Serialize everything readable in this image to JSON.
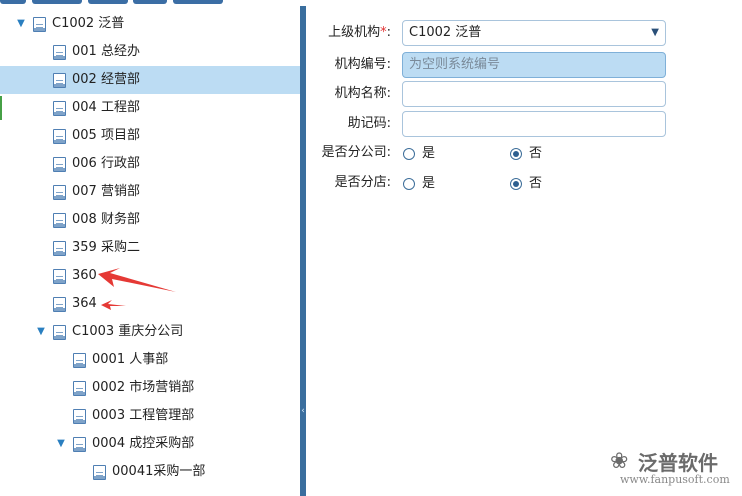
{
  "tree": {
    "nodes": [
      {
        "label": "C1002 泛普",
        "expanded": true
      },
      {
        "label": "001 总经办"
      },
      {
        "label": "002 经营部",
        "selected": true
      },
      {
        "label": "004 工程部"
      },
      {
        "label": "005 项目部"
      },
      {
        "label": "006 行政部"
      },
      {
        "label": "007 营销部"
      },
      {
        "label": "008 财务部"
      },
      {
        "label": "359 采购二"
      },
      {
        "label": "360"
      },
      {
        "label": "364"
      },
      {
        "label": "C1003 重庆分公司",
        "expanded": true
      },
      {
        "label": "0001 人事部"
      },
      {
        "label": "0002 市场营销部"
      },
      {
        "label": "0003 工程管理部"
      },
      {
        "label": "0004 成控采购部",
        "expanded": true
      },
      {
        "label": "00041采购一部"
      }
    ]
  },
  "form": {
    "parent_label": "上级机构",
    "required_mark": "*",
    "colon": ":",
    "parent_value": "C1002 泛普",
    "code_label": "机构编号:",
    "code_placeholder": "为空则系统编号",
    "name_label": "机构名称:",
    "mnemonic_label": "助记码:",
    "branch_company_label": "是否分公司:",
    "branch_store_label": "是否分店:",
    "yes": "是",
    "no": "否",
    "branch_company_value": "否",
    "branch_store_value": "否"
  },
  "watermark": {
    "brand": "泛普软件",
    "site": "www.fanpusoft.com"
  },
  "colors": {
    "accent": "#3a6e9e",
    "selected_row": "#bcdcf3",
    "annotation": "#e53935"
  },
  "icons": {
    "tree_node": "document-icon",
    "expand": "triangle-down-icon",
    "dropdown": "triangle-down-icon"
  }
}
